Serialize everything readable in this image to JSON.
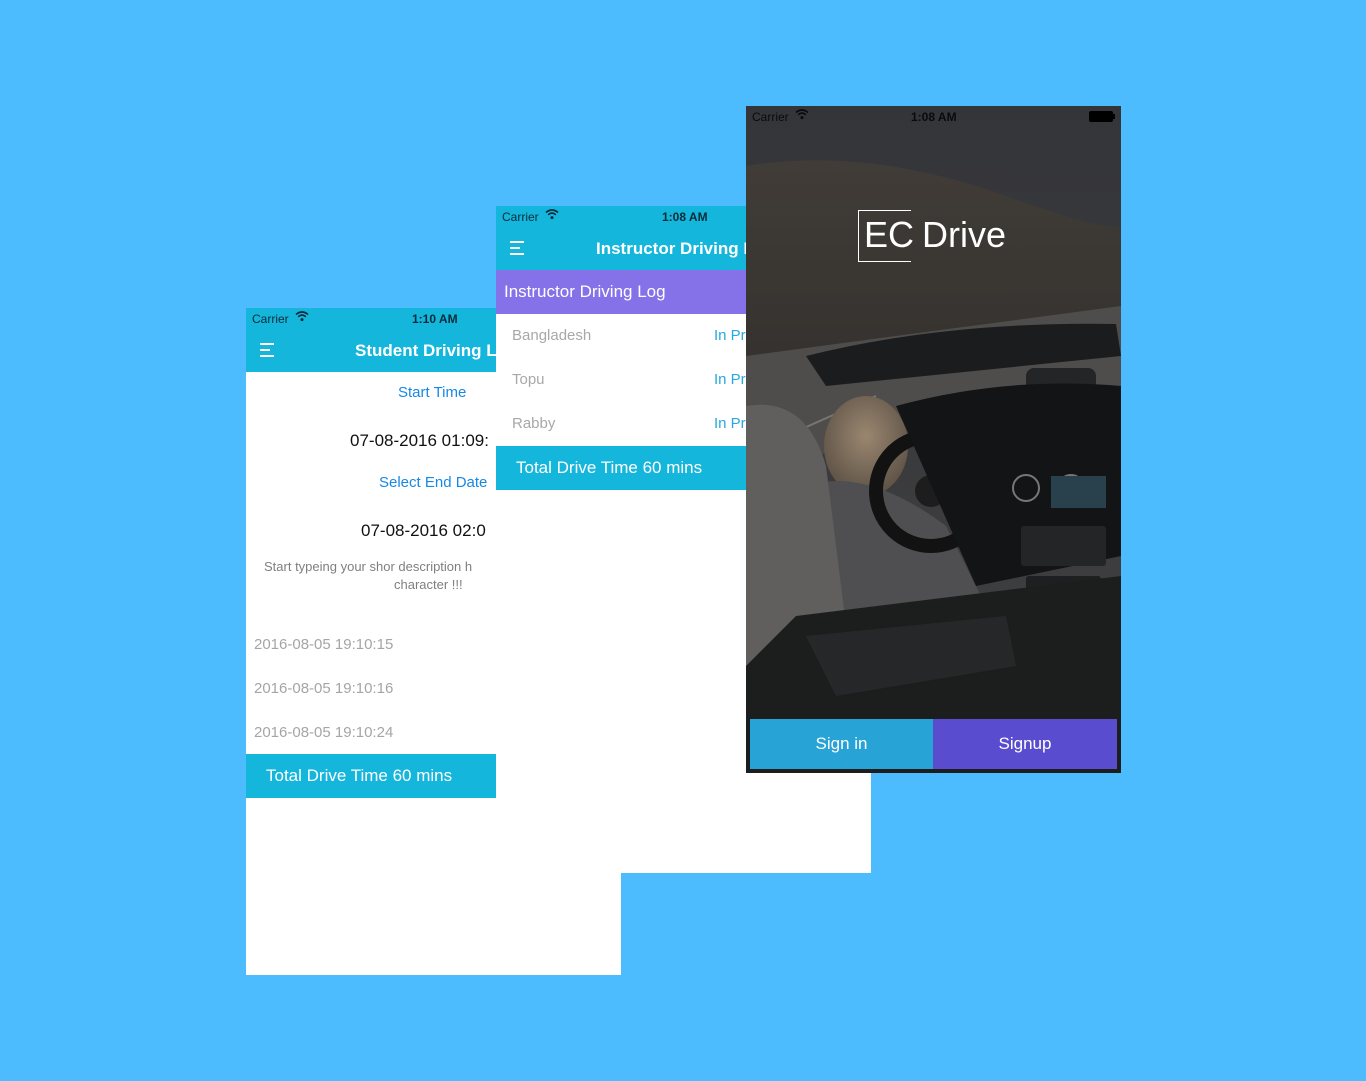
{
  "colors": {
    "background": "#4dbcfe",
    "nav_cyan": "#15b6dc",
    "section_purple": "#8572e8",
    "link_blue": "#1688e6",
    "signin_bg": "#27a3d6",
    "signup_bg": "#5a4ccf"
  },
  "student": {
    "status": {
      "carrier": "Carrier",
      "time": "1:10 AM",
      "wifi_icon": "wifi-icon"
    },
    "nav": {
      "title": "Student Driving Log",
      "menu_icon": "hamburger-menu-icon"
    },
    "start_label": "Start Time",
    "start_value": "07-08-2016 01:09:",
    "end_label": "Select End Date",
    "end_value": "07-08-2016 02:0",
    "description_placeholder_line1": "Start typeing your shor description h",
    "description_placeholder_line2": "character !!!",
    "logs": [
      "2016-08-05 19:10:15",
      "2016-08-05 19:10:16",
      "2016-08-05 19:10:24"
    ],
    "total": "Total Drive Time 60 mins"
  },
  "instructor": {
    "status": {
      "carrier": "Carrier",
      "time": "1:08 AM",
      "wifi_icon": "wifi-icon"
    },
    "nav": {
      "title": "Instructor Driving Log",
      "menu_icon": "hamburger-menu-icon"
    },
    "section_title": "Instructor Driving Log",
    "rows": [
      {
        "name": "Bangladesh",
        "status": "In Pr"
      },
      {
        "name": "Topu",
        "status": "In Pr"
      },
      {
        "name": "Rabby",
        "status": "In Pr"
      }
    ],
    "total": "Total Drive Time 60 mins"
  },
  "landing": {
    "status": {
      "carrier": "Carrier",
      "time": "1:08 AM",
      "wifi_icon": "wifi-icon",
      "battery_icon": "battery-icon"
    },
    "logo_ec": "EC",
    "logo_drive": "Drive",
    "signin_label": "Sign in",
    "signup_label": "Signup"
  }
}
